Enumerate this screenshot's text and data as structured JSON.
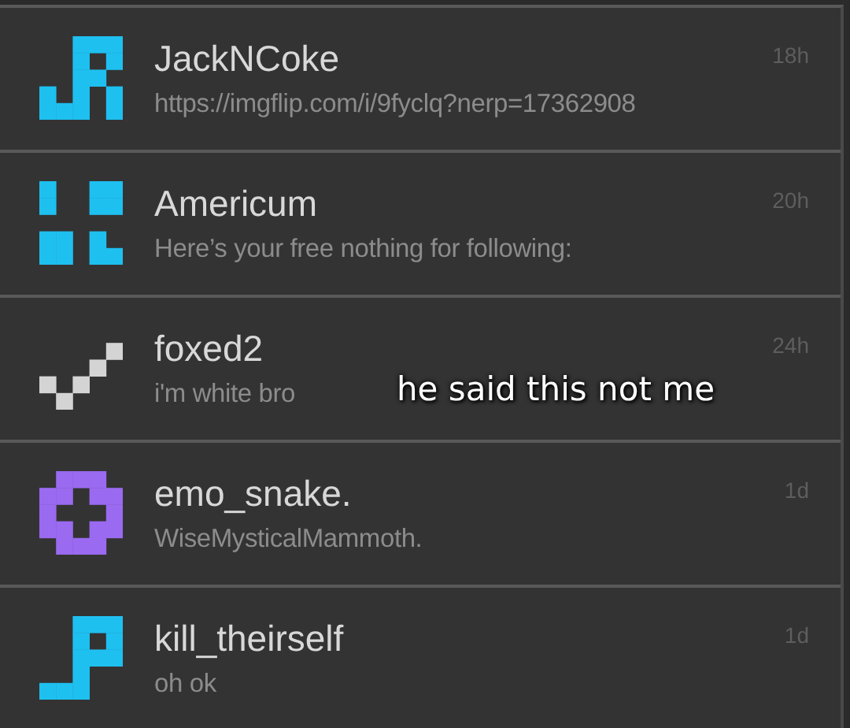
{
  "conversations": [
    {
      "name": "JackNCoke",
      "message": "https://imgflip.com/i/9fyclq?nerp=17362908",
      "time": "18h",
      "color": "#1ec0f0"
    },
    {
      "name": "Americum",
      "message": "Here’s your free nothing for following:",
      "time": "20h",
      "color": "#1ec0f0"
    },
    {
      "name": "foxed2",
      "message": "i'm white bro",
      "time": "24h",
      "color": "#d4d4d4"
    },
    {
      "name": "emo_snake.",
      "message": "WiseMysticalMammoth.",
      "time": "1d",
      "color": "#9a6af0"
    },
    {
      "name": "kill_theirself",
      "message": "oh ok",
      "time": "1d",
      "color": "#1ec0f0"
    }
  ],
  "caption": "he said this not me"
}
